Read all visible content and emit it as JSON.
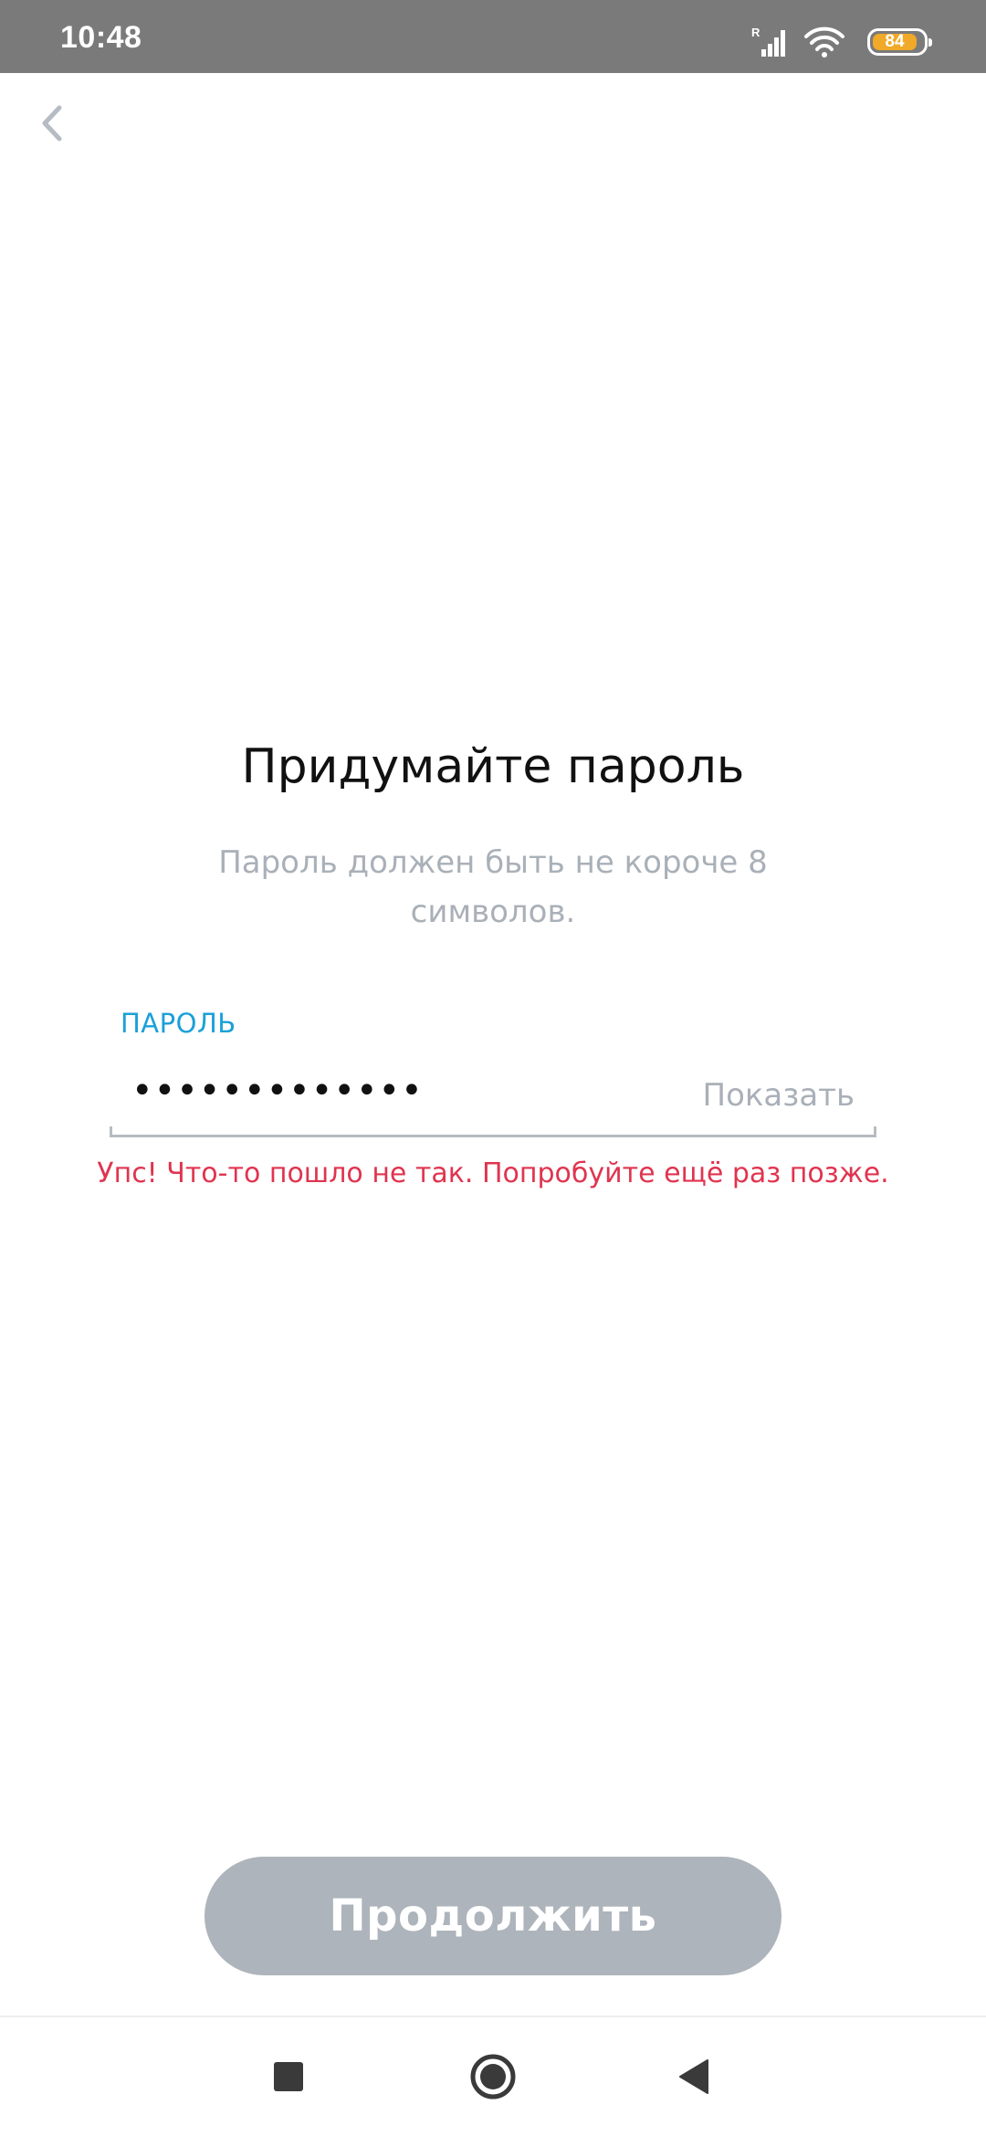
{
  "status_bar": {
    "time": "10:48",
    "signal_badge": "R",
    "battery_level": "84",
    "battery_color": "#f0a928"
  },
  "header": {
    "back_icon": "chevron-left-icon"
  },
  "main": {
    "title": "Придумайте пароль",
    "subtitle": "Пароль должен быть не короче 8 символов.",
    "password_label": "ПАРОЛЬ",
    "password_value": "•••••••••••••",
    "show_toggle_label": "Показать",
    "error_message": "Упс! Что-то пошло не так. Попробуйте ещё раз позже."
  },
  "footer": {
    "continue_label": "Продолжить"
  },
  "navigation": {
    "recents_icon": "square-icon",
    "home_icon": "circle-icon",
    "back_icon": "triangle-back-icon"
  },
  "colors": {
    "accent": "#1aa0d8",
    "error": "#e0344f",
    "button_disabled": "#adb4bb",
    "status_bar": "#7a7a7a"
  }
}
